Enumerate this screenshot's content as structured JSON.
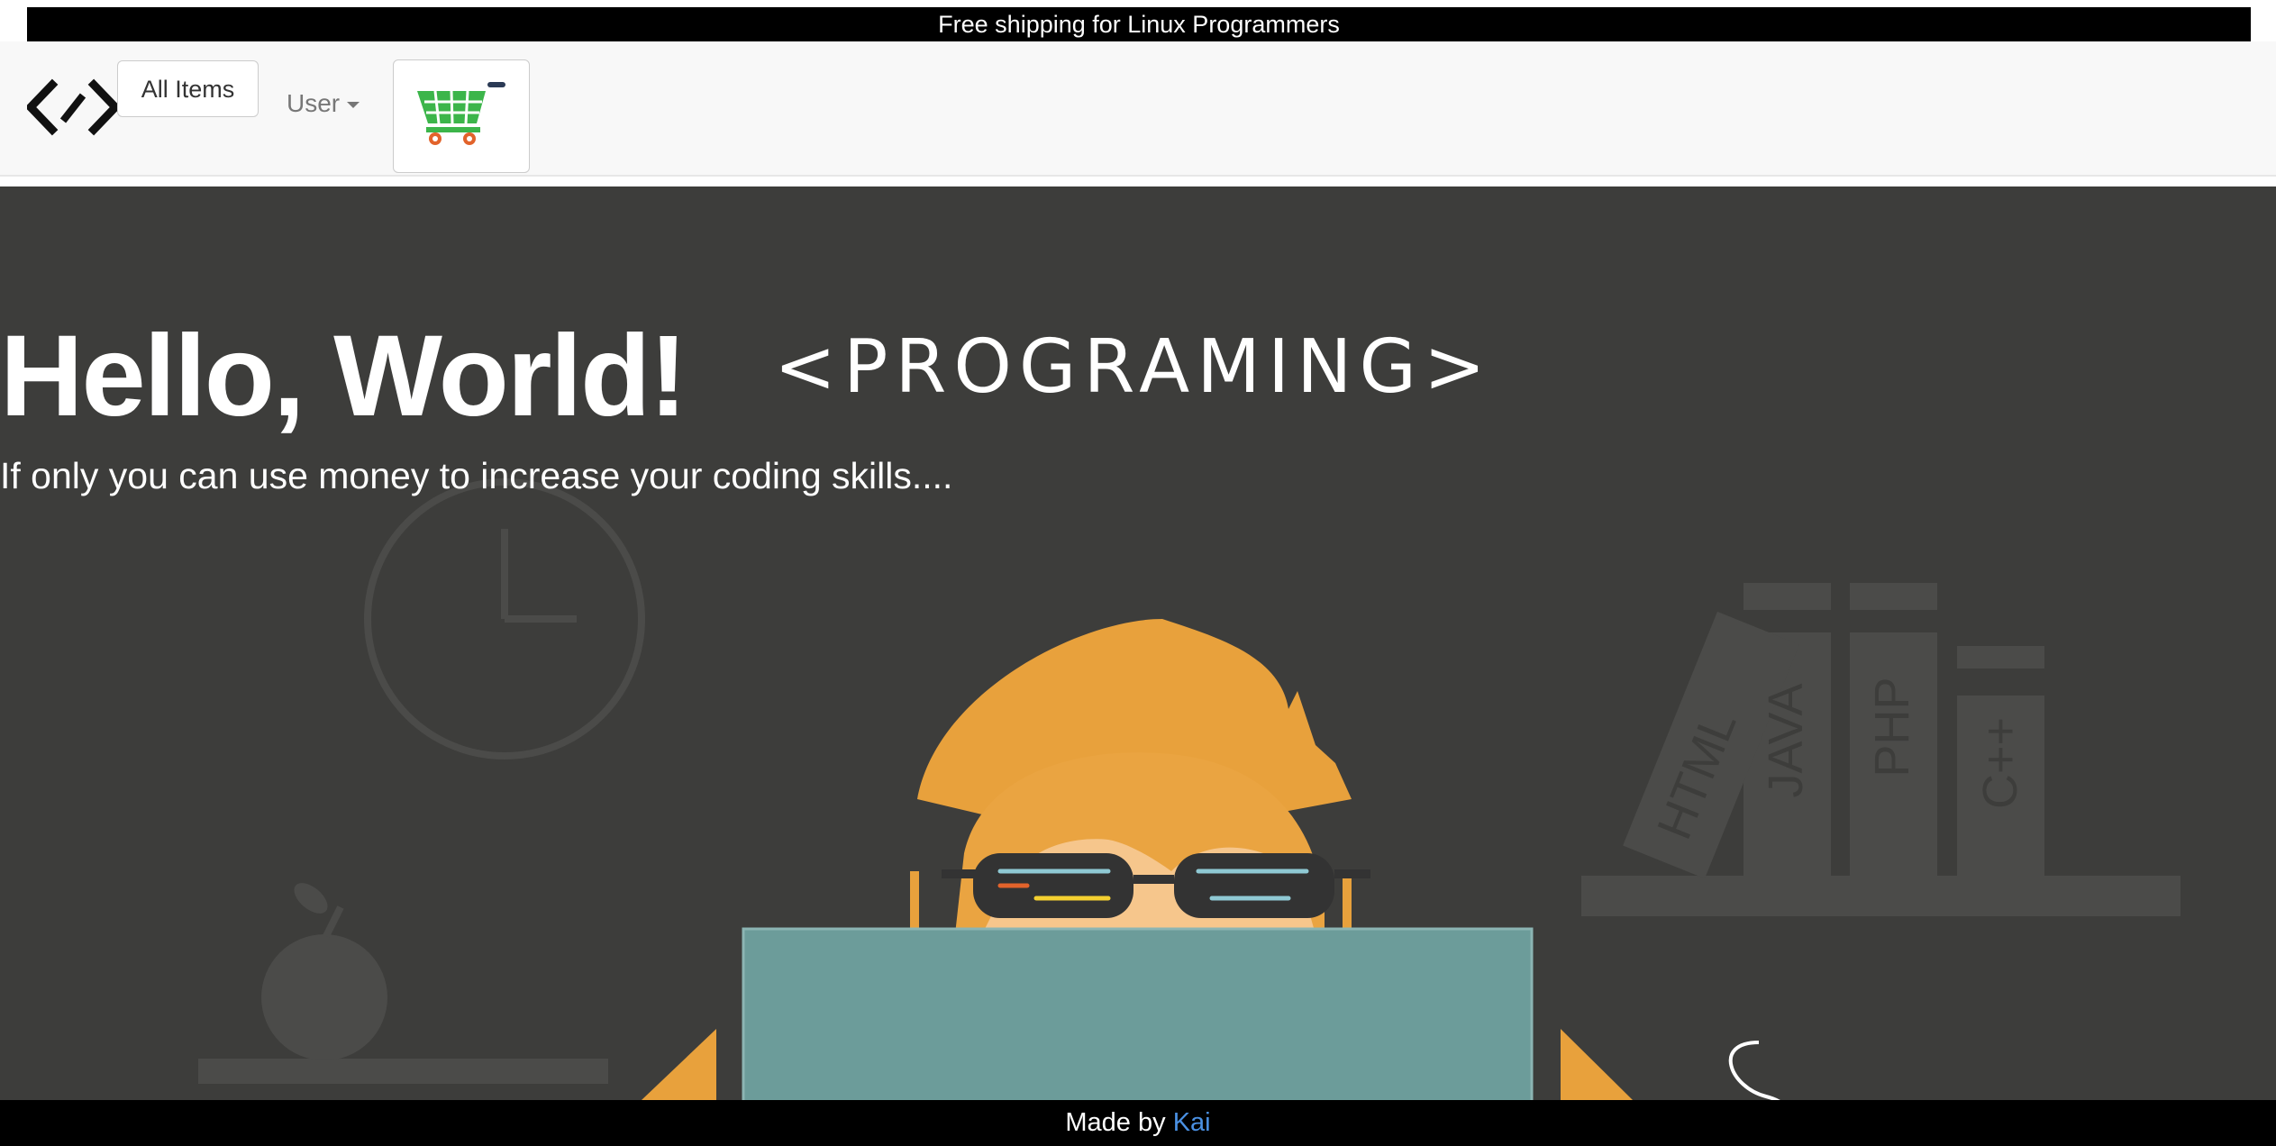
{
  "banner": {
    "text": "Free shipping for Linux Programmers"
  },
  "nav": {
    "logo_icon": "code-brackets-icon",
    "all_items_label": "All Items",
    "user_label": "User",
    "cart_icon": "shopping-cart-icon"
  },
  "hero": {
    "title": "Hello, World!",
    "subtitle": "If only you can use money to increase your coding skills....",
    "illustration": {
      "banner_text": "<PROGRAMING>",
      "book_labels": [
        "HTML",
        "JAVA",
        "PHP",
        "C++"
      ]
    }
  },
  "footer": {
    "prefix": "Made by ",
    "author": "Kai"
  },
  "colors": {
    "hero_bg": "#3d3d3b",
    "accent_orange": "#e8a13c",
    "laptop": "#6c9c9a",
    "link": "#4a90e2",
    "cart_green": "#3cb54a"
  }
}
